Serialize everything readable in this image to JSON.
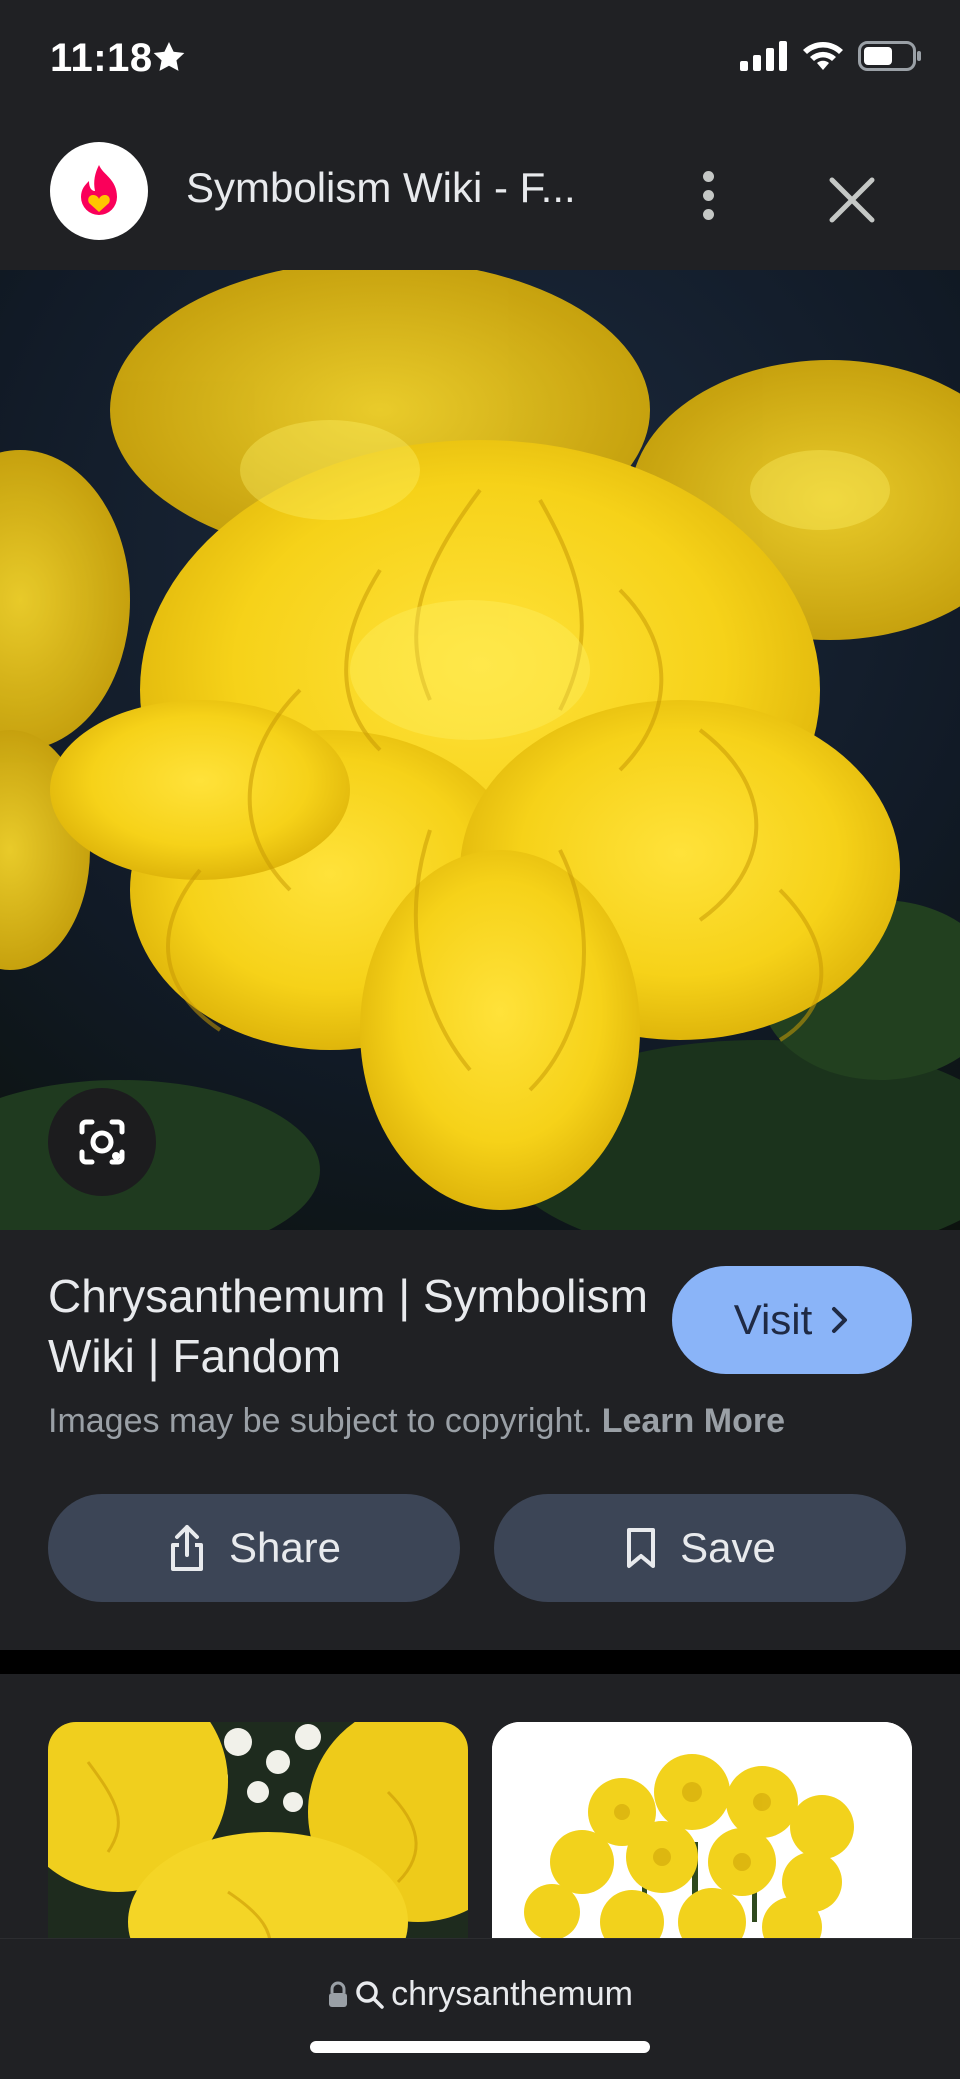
{
  "status_bar": {
    "time": "11:18",
    "icons": [
      "star-icon",
      "cellular-signal-icon",
      "wifi-icon",
      "battery-icon"
    ]
  },
  "header": {
    "title": "Symbolism Wiki - F...",
    "logo_icon": "fandom-logo-icon",
    "menu_icon": "more-vert-icon",
    "close_icon": "close-icon"
  },
  "image": {
    "subject": "yellow chrysanthemum flowers",
    "lens_icon": "google-lens-icon"
  },
  "result": {
    "title": "Chrysanthemum | Symbolism Wiki | Fandom",
    "visit_label": "Visit",
    "copyright_notice": "Images may be subject to copyright.",
    "learn_more_label": "Learn More",
    "share_label": "Share",
    "save_label": "Save"
  },
  "bottom_bar": {
    "query": "chrysanthemum",
    "lock_icon": "lock-icon",
    "search_icon": "search-icon"
  },
  "colors": {
    "background": "#202124",
    "visit_button": "#8ab4f8",
    "action_button": "#3c4556",
    "flower_yellow": "#f5d51f"
  }
}
